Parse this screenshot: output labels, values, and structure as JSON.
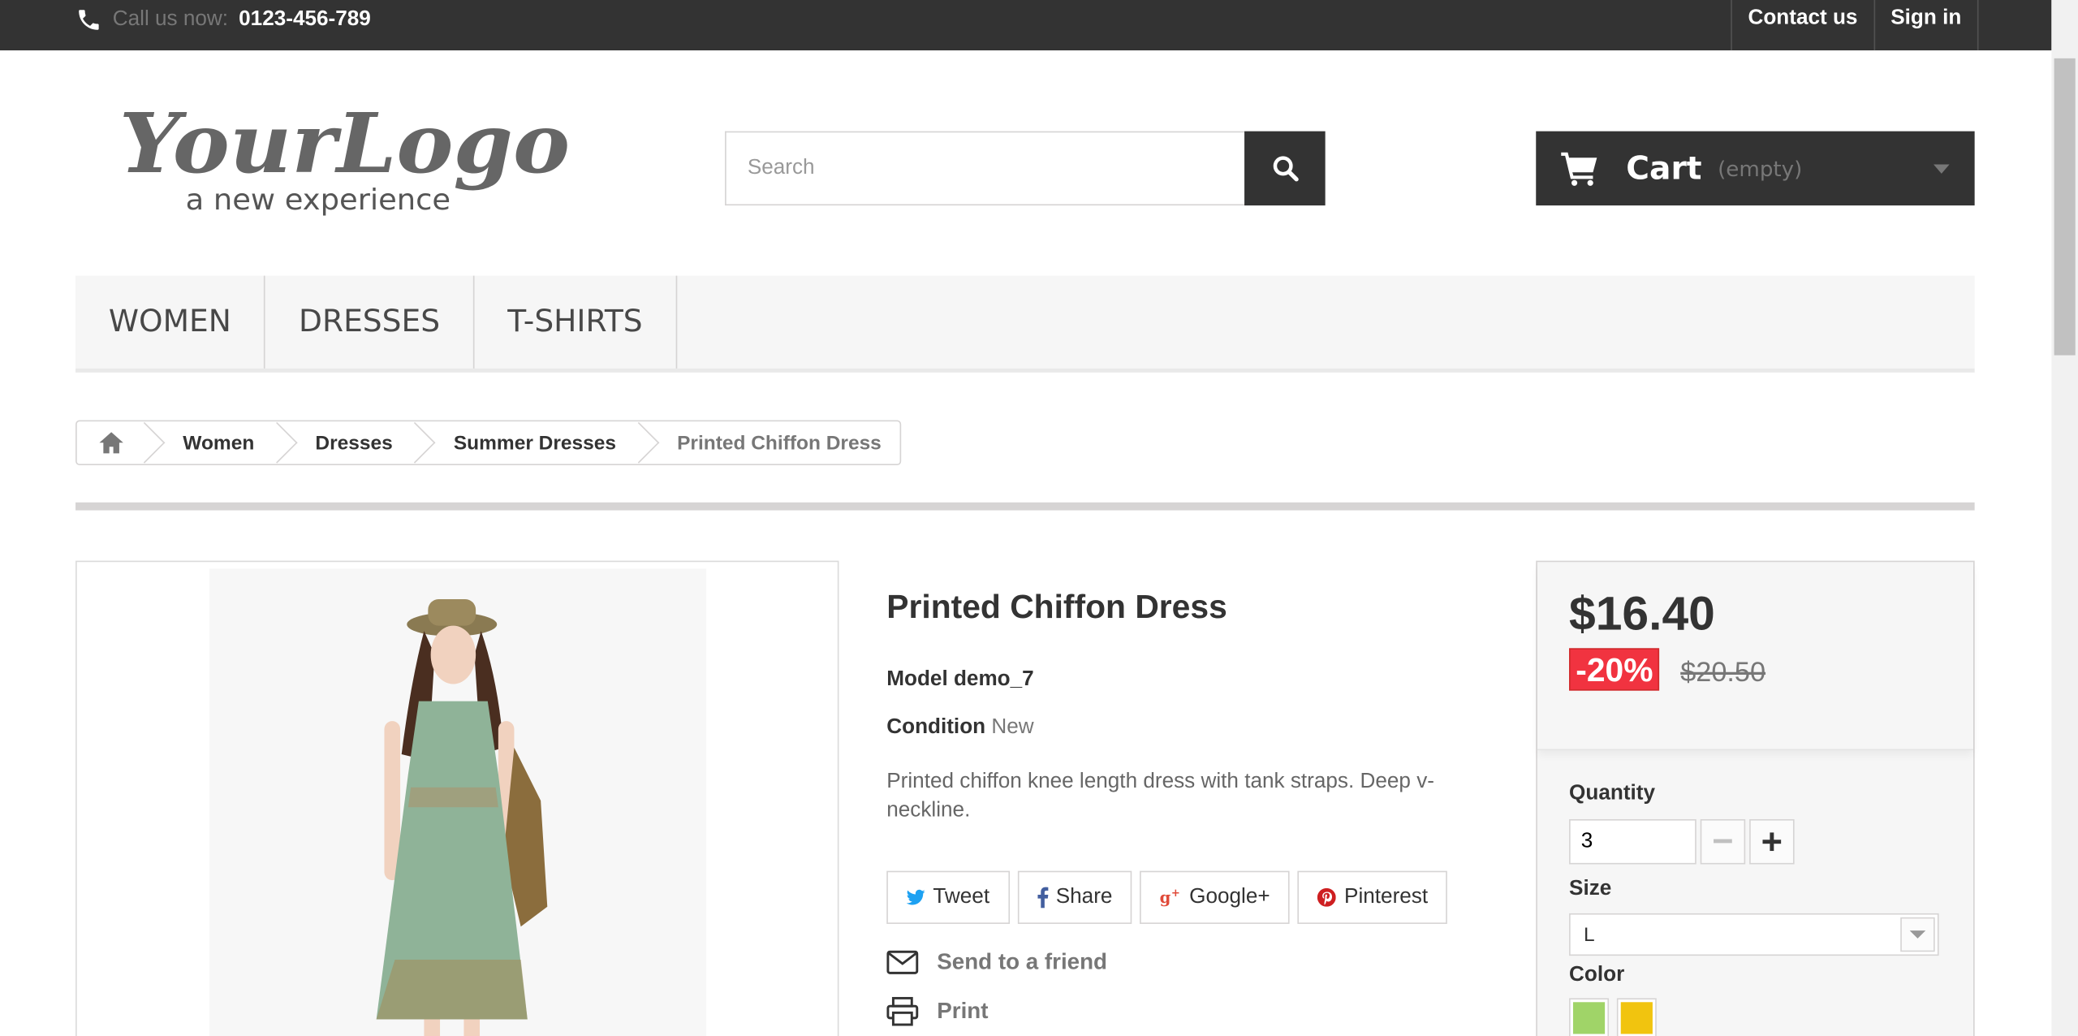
{
  "topbar": {
    "phone_prefix": "Call us now:",
    "phone_number": "0123-456-789",
    "links": [
      "Contact us",
      "Sign in"
    ]
  },
  "logo": {
    "line1": "YourLogo",
    "line2": "a new experience"
  },
  "search": {
    "placeholder": "Search"
  },
  "cart": {
    "label": "Cart",
    "status": "(empty)"
  },
  "menu": [
    "WOMEN",
    "DRESSES",
    "T-SHIRTS"
  ],
  "breadcrumb": [
    "Women",
    "Dresses",
    "Summer Dresses",
    "Printed Chiffon Dress"
  ],
  "product": {
    "title": "Printed Chiffon Dress",
    "model": "Model demo_7",
    "condition_label": "Condition",
    "condition_value": "New",
    "description": "Printed chiffon knee length dress with tank straps. Deep v-neckline.",
    "social": [
      "Tweet",
      "Share",
      "Google+",
      "Pinterest"
    ],
    "send_to_friend": "Send to a friend",
    "print": "Print"
  },
  "buy": {
    "price": "$16.40",
    "discount": "-20%",
    "old_price": "$20.50",
    "quantity_label": "Quantity",
    "quantity_value": "3",
    "size_label": "Size",
    "size_value": "L",
    "color_label": "Color",
    "colors": [
      "#a0d468",
      "#f1c40f"
    ]
  },
  "colors": {
    "topbar": "#333333",
    "accent_red": "#f13340"
  }
}
